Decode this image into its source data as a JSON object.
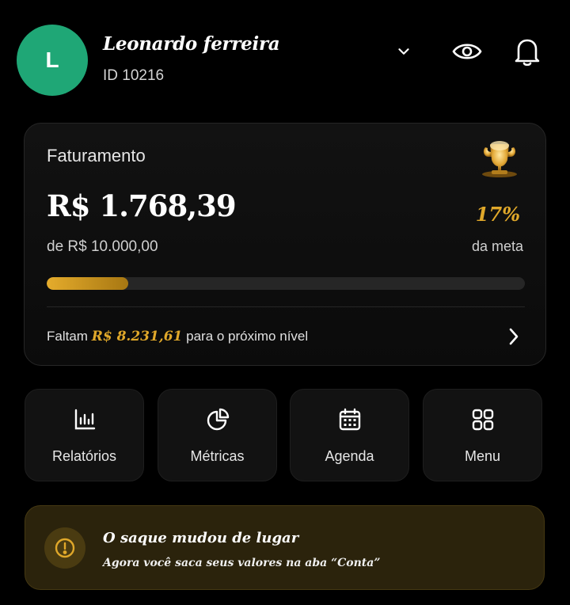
{
  "user": {
    "initial": "L",
    "name": "Leonardo ferreira",
    "id": "ID 10216"
  },
  "header": {
    "icons": [
      "chevron-down-icon",
      "eye-icon",
      "bell-icon"
    ]
  },
  "revenue": {
    "title": "Faturamento",
    "amount": "R$ 1.768,39",
    "goal_text": "de R$ 10.000,00",
    "percent": "17%",
    "percent_label": "da meta",
    "progress_fraction": 0.17,
    "remaining_prefix": "Faltam",
    "remaining_amount": "R$ 8.231,61",
    "remaining_suffix": "para o próximo nível",
    "accent_color": "#e0a82a"
  },
  "quick_actions": [
    {
      "label": "Relatórios",
      "icon": "bar-chart-icon"
    },
    {
      "label": "Métricas",
      "icon": "pie-chart-icon"
    },
    {
      "label": "Agenda",
      "icon": "calendar-icon"
    },
    {
      "label": "Menu",
      "icon": "grid-icon"
    }
  ],
  "notice": {
    "title": "O saque mudou de lugar",
    "text": "Agora você saca seus valores na aba “Conta”",
    "icon": "alert-circle-icon"
  }
}
